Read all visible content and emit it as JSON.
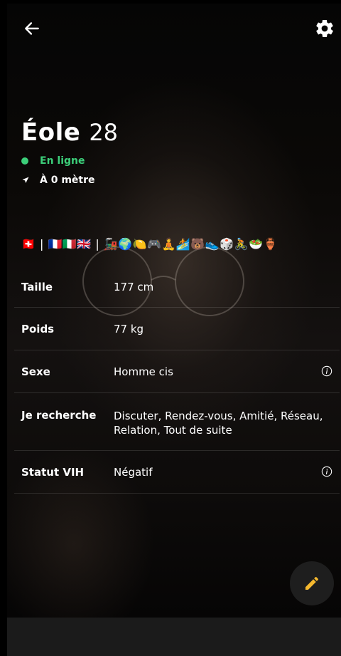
{
  "profile": {
    "name": "Éole",
    "age": "28",
    "status": "En ligne",
    "distance": "À 0 mètre",
    "tags": "🇨🇭 | 🇫🇷🇮🇹🇬🇧 | 🚂🌍🍋🎮🧘🏄🐻👟🎲🚴🥗🏺"
  },
  "details": [
    {
      "label": "Taille",
      "value": "177 cm",
      "info": false
    },
    {
      "label": "Poids",
      "value": "77 kg",
      "info": false
    },
    {
      "label": "Sexe",
      "value": "Homme cis",
      "info": true
    },
    {
      "label": "Je recherche",
      "value": "Discuter, Rendez-vous, Amitié, Réseau, Relation, Tout de suite",
      "info": false
    },
    {
      "label": "Statut VIH",
      "value": "Négatif",
      "info": true
    }
  ],
  "colors": {
    "online": "#3ccf7a",
    "edit_accent": "#f5b82e",
    "background": "#000000"
  },
  "icons": {
    "back": "back-arrow-icon",
    "settings": "gear-icon",
    "location": "navigation-arrow-icon",
    "info": "info-icon",
    "edit": "pencil-icon"
  }
}
